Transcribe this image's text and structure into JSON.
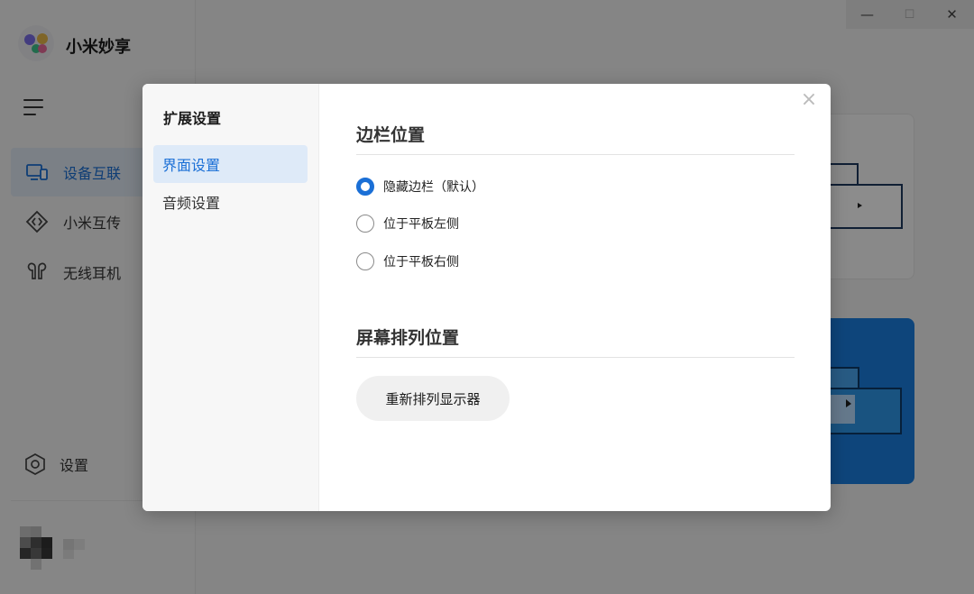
{
  "app": {
    "title": "小米妙享"
  },
  "sidebar": {
    "items": [
      {
        "label": "设备互联",
        "icon": "devices-icon",
        "active": true
      },
      {
        "label": "小米互传",
        "icon": "transfer-icon",
        "active": false
      },
      {
        "label": "无线耳机",
        "icon": "earbuds-icon",
        "active": false
      }
    ],
    "settings_label": "设置"
  },
  "window_controls": {
    "minimize": "—",
    "maximize": "☐",
    "close": "✕"
  },
  "dialog": {
    "side_title": "扩展设置",
    "tabs": [
      {
        "label": "界面设置",
        "active": true
      },
      {
        "label": "音频设置",
        "active": false
      }
    ],
    "close": "×",
    "sections": {
      "sidebar_position": {
        "title": "边栏位置",
        "options": [
          {
            "label": "隐藏边栏（默认）",
            "checked": true
          },
          {
            "label": "位于平板左侧",
            "checked": false
          },
          {
            "label": "位于平板右侧",
            "checked": false
          }
        ]
      },
      "screen_arrangement": {
        "title": "屏幕排列位置",
        "button_label": "重新排列显示器"
      }
    }
  },
  "colors": {
    "accent": "#1a6fd6",
    "active_bg": "#deeaf8",
    "card_blue": "#1b7fe0"
  }
}
